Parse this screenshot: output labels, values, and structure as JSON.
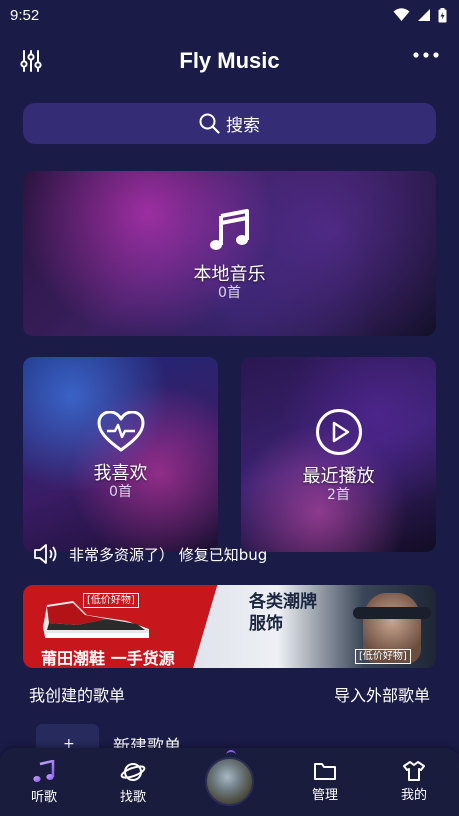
{
  "status_bar": {
    "time": "9:52"
  },
  "app_bar": {
    "title": "Fly Music"
  },
  "search": {
    "label": "搜索"
  },
  "cards": {
    "local": {
      "title": "本地音乐",
      "count": "0首"
    },
    "favorites": {
      "title": "我喜欢",
      "count": "0首"
    },
    "recent": {
      "title": "最近播放",
      "count": "2首"
    }
  },
  "notice": {
    "text": "非常多资源了） 修复已知bug"
  },
  "banner": {
    "tag_left": "[低价好物]",
    "slogan": "莆田潮鞋  一手货源",
    "headline_line1": "各类潮牌",
    "headline_line2": "服饰",
    "tag_right": "[低价好物]"
  },
  "playlists": {
    "my_created": "我创建的歌单",
    "import_external": "导入外部歌单",
    "new_playlist": "新建歌单"
  },
  "bottom_nav": {
    "items": [
      {
        "label": "听歌",
        "icon": "music-note-icon"
      },
      {
        "label": "找歌",
        "icon": "planet-icon"
      },
      {
        "label": "管理",
        "icon": "folder-icon"
      },
      {
        "label": "我的",
        "icon": "shirt-icon"
      }
    ]
  },
  "colors": {
    "background": "#1b1b48",
    "search_bg": "#342c74",
    "accent": "#8b5cf6",
    "banner_red": "#c7161c"
  }
}
